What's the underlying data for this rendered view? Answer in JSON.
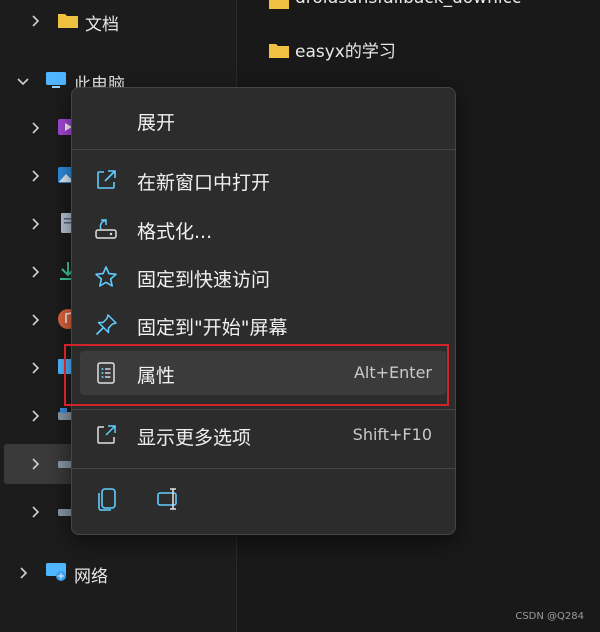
{
  "nav": {
    "documents_label": "文档",
    "this_pc_label": "此电脑",
    "network_label": "网络"
  },
  "content": {
    "folders": [
      "droidsansfallback_downlcc",
      "easyx的学习"
    ]
  },
  "context_menu": {
    "expand": "展开",
    "open_new_window": "在新窗口中打开",
    "format": "格式化...",
    "pin_quick_access": "固定到快速访问",
    "pin_start": "固定到\"开始\"屏幕",
    "properties": "属性",
    "properties_shortcut": "Alt+Enter",
    "show_more": "显示更多选项",
    "show_more_shortcut": "Shift+F10"
  },
  "colors": {
    "accent": "#60cdff",
    "folder": "#f0c040",
    "highlight_box": "#d2232a"
  },
  "watermark": "CSDN @Q284"
}
